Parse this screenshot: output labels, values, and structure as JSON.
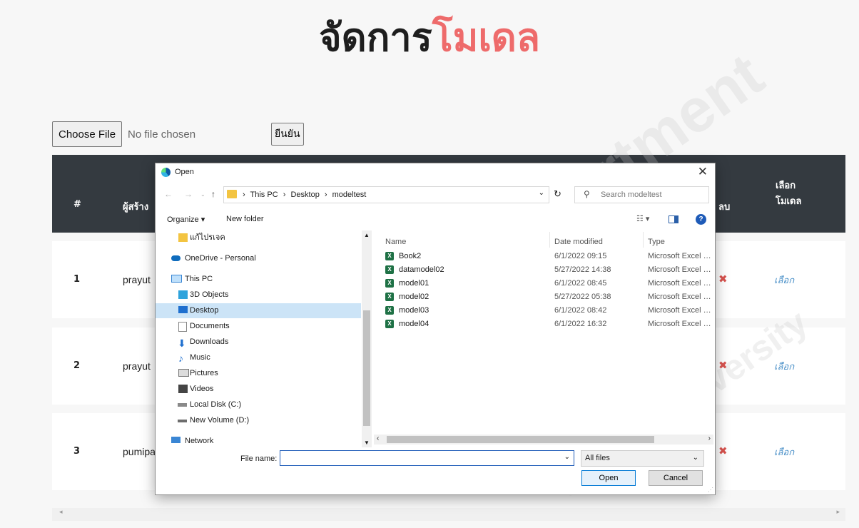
{
  "heading": {
    "part1": "จัดการ",
    "part2": "โมเดล"
  },
  "upload": {
    "choose_label": "Choose File",
    "status": "No file chosen",
    "confirm_label": "ยืนยัน"
  },
  "table": {
    "headers": {
      "num": "#",
      "creator": "ผู้สร้าง",
      "delete": "ลบ",
      "select_line1": "เลือก",
      "select_line2": "โมเดล"
    },
    "rows": [
      {
        "num": "1",
        "creator": "prayut",
        "delete": "✖",
        "select": "เลือก"
      },
      {
        "num": "2",
        "creator": "prayut",
        "delete": "✖",
        "select": "เลือก"
      },
      {
        "num": "3",
        "creator": "pumipa",
        "delete": "✖",
        "select": "เลือก"
      }
    ]
  },
  "watermark": {
    "line1": "Department",
    "line2": "akham University"
  },
  "dialog": {
    "title": "Open",
    "close": "✕",
    "breadcrumb": [
      "This PC",
      "›",
      "Desktop",
      "›",
      "modeltest"
    ],
    "breadcrumb_lead": "›",
    "search_placeholder": "Search modeltest",
    "organize_label": "Organize ▾",
    "new_folder_label": "New folder",
    "help": "?",
    "nav_items": [
      {
        "label": "แก้ไปรเจค",
        "icon": "folder-icon"
      },
      {
        "label": "OneDrive - Personal",
        "icon": "cloud-icon"
      },
      {
        "label": "This PC",
        "icon": "computer-icon"
      },
      {
        "label": "3D Objects",
        "icon": "cube-icon"
      },
      {
        "label": "Desktop",
        "icon": "desktop-icon"
      },
      {
        "label": "Documents",
        "icon": "document-icon"
      },
      {
        "label": "Downloads",
        "icon": "download-icon"
      },
      {
        "label": "Music",
        "icon": "music-icon"
      },
      {
        "label": "Pictures",
        "icon": "picture-icon"
      },
      {
        "label": "Videos",
        "icon": "video-icon"
      },
      {
        "label": "Local Disk (C:)",
        "icon": "disk-icon"
      },
      {
        "label": "New Volume (D:)",
        "icon": "drive-icon"
      },
      {
        "label": "Network",
        "icon": "network-icon"
      }
    ],
    "columns": {
      "name": "Name",
      "date": "Date modified",
      "type": "Type"
    },
    "files": [
      {
        "name": "Book2",
        "date": "6/1/2022 09:15",
        "type": "Microsoft Excel W..."
      },
      {
        "name": "datamodel02",
        "date": "5/27/2022 14:38",
        "type": "Microsoft Excel C..."
      },
      {
        "name": "model01",
        "date": "6/1/2022 08:45",
        "type": "Microsoft Excel C..."
      },
      {
        "name": "model02",
        "date": "5/27/2022 05:38",
        "type": "Microsoft Excel C..."
      },
      {
        "name": "model03",
        "date": "6/1/2022 08:42",
        "type": "Microsoft Excel C..."
      },
      {
        "name": "model04",
        "date": "6/1/2022 16:32",
        "type": "Microsoft Excel C..."
      }
    ],
    "file_name_label": "File name:",
    "file_name_value": "",
    "file_type_value": "All files",
    "open_label": "Open",
    "cancel_label": "Cancel"
  }
}
